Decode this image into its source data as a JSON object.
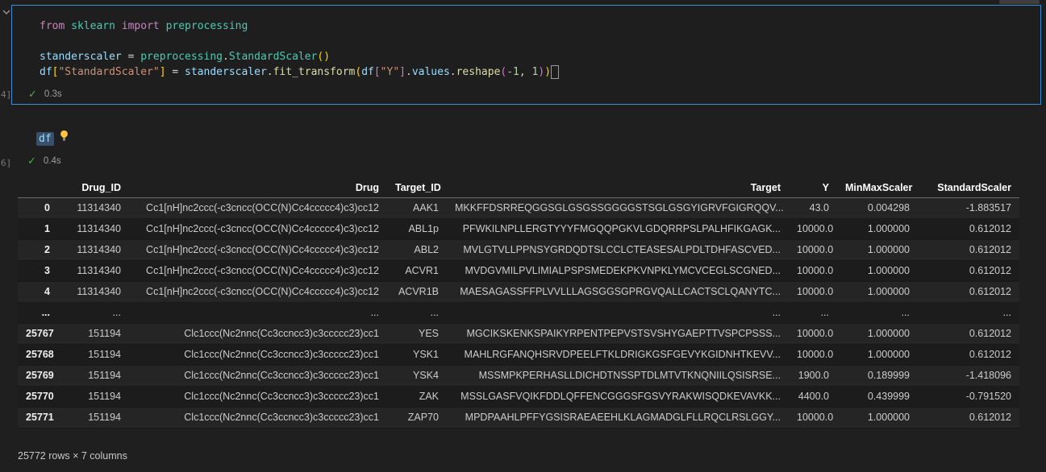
{
  "icons": {
    "collapse": "chevron-down",
    "cell_status": "check",
    "quick_fix": "lightbulb"
  },
  "colors": {
    "focused_cell_border": "#3f8cd6",
    "success_check": "#47b04b",
    "page_background": "#1f1f1f",
    "word_highlight": "#38506b"
  },
  "cells": [
    {
      "execution_label": "4]",
      "status_icon": "✓",
      "exec_time": "0.3s",
      "code_lines": [
        [
          [
            "kw",
            "from"
          ],
          [
            "pl",
            " "
          ],
          [
            "type",
            "sklearn"
          ],
          [
            "pl",
            " "
          ],
          [
            "kw",
            "import"
          ],
          [
            "pl",
            " "
          ],
          [
            "type",
            "preprocessing"
          ]
        ],
        [],
        [
          [
            "var",
            "standerscaler"
          ],
          [
            "pl",
            " = "
          ],
          [
            "type",
            "preprocessing"
          ],
          [
            "pl",
            "."
          ],
          [
            "type",
            "StandardScaler"
          ],
          [
            "b1",
            "()"
          ]
        ],
        [
          [
            "var",
            "df"
          ],
          [
            "b1",
            "["
          ],
          [
            "str",
            "\"StandardScaler\""
          ],
          [
            "b1",
            "]"
          ],
          [
            "pl",
            " = "
          ],
          [
            "var",
            "standerscaler"
          ],
          [
            "pl",
            "."
          ],
          [
            "fn",
            "fit_transform"
          ],
          [
            "b1",
            "("
          ],
          [
            "var",
            "df"
          ],
          [
            "b2",
            "["
          ],
          [
            "str",
            "\"Y\""
          ],
          [
            "b2",
            "]"
          ],
          [
            "pl",
            "."
          ],
          [
            "var",
            "values"
          ],
          [
            "pl",
            "."
          ],
          [
            "fn",
            "reshape"
          ],
          [
            "b2",
            "("
          ],
          [
            "num",
            "-1"
          ],
          [
            "pl",
            ", "
          ],
          [
            "num",
            "1"
          ],
          [
            "b2",
            ")"
          ],
          [
            "b1",
            ")"
          ],
          [
            "cursor",
            ""
          ]
        ]
      ]
    },
    {
      "execution_label": "6]",
      "status_icon": "✓",
      "exec_time": "0.4s",
      "code_text": "df"
    }
  ],
  "table": {
    "columns": [
      "",
      "Drug_ID",
      "Drug",
      "Target_ID",
      "Target",
      "Y",
      "MinMaxScaler",
      "StandardScaler"
    ],
    "rows": [
      [
        "0",
        "11314340",
        "Cc1[nH]nc2ccc(-c3cncc(OCC(N)Cc4ccccc4)c3)cc12",
        "AAK1",
        "MKKFFDSRREQGGSGLGSGSSGGGGSTSGLGSGYIGRVFGIGRQQV...",
        "43.0",
        "0.004298",
        "-1.883517"
      ],
      [
        "1",
        "11314340",
        "Cc1[nH]nc2ccc(-c3cncc(OCC(N)Cc4ccccc4)c3)cc12",
        "ABL1p",
        "PFWKILNPLLERGTYYYFMGQQPGKVLGDQRRPSLPALHFIKGAGK...",
        "10000.0",
        "1.000000",
        "0.612012"
      ],
      [
        "2",
        "11314340",
        "Cc1[nH]nc2ccc(-c3cncc(OCC(N)Cc4ccccc4)c3)cc12",
        "ABL2",
        "MVLGTVLLPPNSYGRDQDTSLCCLCTEASESALPDLTDHFASCVED...",
        "10000.0",
        "1.000000",
        "0.612012"
      ],
      [
        "3",
        "11314340",
        "Cc1[nH]nc2ccc(-c3cncc(OCC(N)Cc4ccccc4)c3)cc12",
        "ACVR1",
        "MVDGVMILPVLIMIALPSPSMEDEKPKVNPKLYMCVCEGLSCGNED...",
        "10000.0",
        "1.000000",
        "0.612012"
      ],
      [
        "4",
        "11314340",
        "Cc1[nH]nc2ccc(-c3cncc(OCC(N)Cc4ccccc4)c3)cc12",
        "ACVR1B",
        "MAESAGASSFFPLVVLLLAGSGGSGPRGVQALLCACTSCLQANYTC...",
        "10000.0",
        "1.000000",
        "0.612012"
      ],
      [
        "...",
        "...",
        "...",
        "...",
        "...",
        "...",
        "...",
        "..."
      ],
      [
        "25767",
        "151194",
        "Clc1ccc(Nc2nnc(Cc3ccncc3)c3ccccc23)cc1",
        "YES",
        "MGCIKSKENKSPAIKYRPENTPEPVSTSVSHYGAEPTTVSPCPSSS...",
        "10000.0",
        "1.000000",
        "0.612012"
      ],
      [
        "25768",
        "151194",
        "Clc1ccc(Nc2nnc(Cc3ccncc3)c3ccccc23)cc1",
        "YSK1",
        "MAHLRGFANQHSRVDPEELFTKLDRIGKGSFGEVYKGIDNHTKEVV...",
        "10000.0",
        "1.000000",
        "0.612012"
      ],
      [
        "25769",
        "151194",
        "Clc1ccc(Nc2nnc(Cc3ccncc3)c3ccccc23)cc1",
        "YSK4",
        "MSSMPKPERHASLLDICHDTNSSPTDLMTVTKNQNIILQSISRSE...",
        "1900.0",
        "0.189999",
        "-1.418096"
      ],
      [
        "25770",
        "151194",
        "Clc1ccc(Nc2nnc(Cc3ccncc3)c3ccccc23)cc1",
        "ZAK",
        "MSSLGASFVQIKFDDLQFFENCGGGSFGSVYRAKWISQDKEVAVKK...",
        "4400.0",
        "0.439999",
        "-0.791520"
      ],
      [
        "25771",
        "151194",
        "Clc1ccc(Nc2nnc(Cc3ccncc3)c3ccccc23)cc1",
        "ZAP70",
        "MPDPAAHLPFFYGSISRAEAEEHLKLAGMADGLFLLRQCLRSLGGY...",
        "10000.0",
        "1.000000",
        "0.612012"
      ]
    ],
    "footer": "25772 rows × 7 columns"
  }
}
